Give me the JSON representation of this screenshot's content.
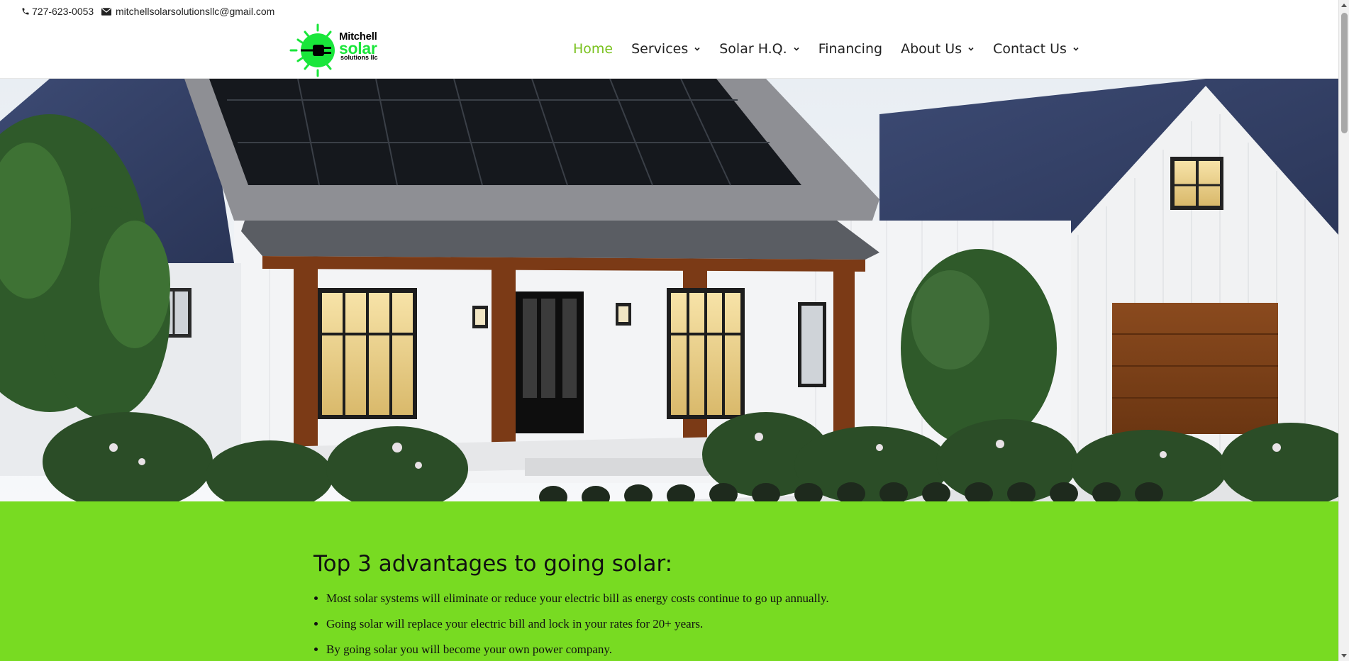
{
  "topbar": {
    "phone": "727-623-0053",
    "email": "mitchellsolarsolutionsllc@gmail.com"
  },
  "logo": {
    "line1": "Mitchell",
    "line2": "solar",
    "line3": "solutions llc",
    "colors": {
      "sun": "#19e63a",
      "text": "#000000"
    }
  },
  "nav": {
    "items": [
      {
        "label": "Home",
        "active": true,
        "has_dropdown": false
      },
      {
        "label": "Services",
        "active": false,
        "has_dropdown": true
      },
      {
        "label": "Solar H.Q.",
        "active": false,
        "has_dropdown": true
      },
      {
        "label": "Financing",
        "active": false,
        "has_dropdown": false
      },
      {
        "label": "About Us",
        "active": false,
        "has_dropdown": true
      },
      {
        "label": "Contact Us",
        "active": false,
        "has_dropdown": true
      }
    ],
    "active_color": "#7ac21f"
  },
  "advantages": {
    "heading": "Top 3 advantages to going solar:",
    "items": [
      "Most solar systems will eliminate or reduce your electric bill as energy costs continue to go up annually.",
      "Going solar will replace your electric bill and lock in your rates for 20+ years.",
      "By going solar you will become your own power company."
    ],
    "background": "#78db22"
  }
}
